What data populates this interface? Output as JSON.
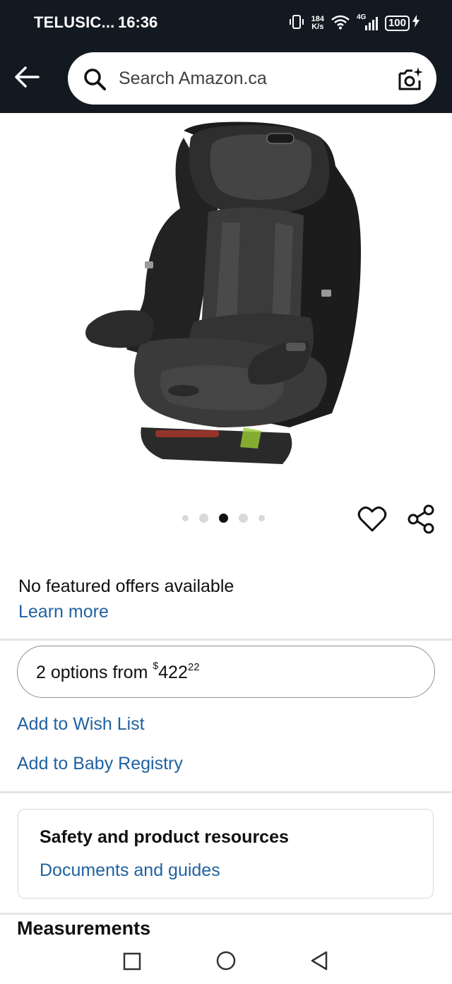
{
  "status_bar": {
    "carrier": "TELUSIC...",
    "time": "16:36",
    "network_speed_value": "184",
    "network_speed_unit": "K/s",
    "network_type": "4G",
    "battery": "100"
  },
  "header": {
    "search_placeholder": "Search Amazon.ca"
  },
  "carousel": {
    "total_images": 5,
    "active_index": 2
  },
  "offers": {
    "no_offers_text": "No featured offers available",
    "learn_more": "Learn more"
  },
  "options": {
    "prefix": "2 options from ",
    "currency": "$",
    "price_whole": "422",
    "price_cents": "22"
  },
  "actions": {
    "wishlist": "Add to Wish List",
    "registry": "Add to Baby Registry"
  },
  "resources": {
    "title": "Safety and product resources",
    "link": "Documents and guides"
  },
  "sections": {
    "measurements": "Measurements"
  },
  "colors": {
    "header_bg": "#131921",
    "link": "#2162a1",
    "text": "#0f1111"
  }
}
